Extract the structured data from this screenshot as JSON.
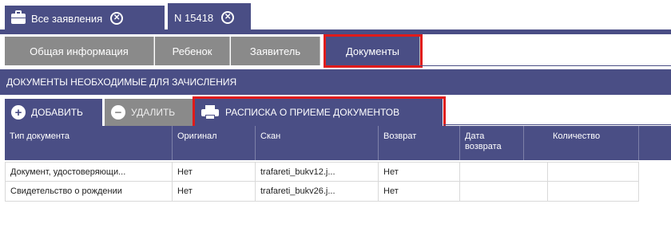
{
  "doc_tabs": [
    {
      "label": "Все заявления",
      "icon": "briefcase-icon",
      "close": "close-icon"
    },
    {
      "label": "N 15418",
      "close": "close-icon"
    }
  ],
  "section_tabs": [
    "Общая информация",
    "Ребенок",
    "Заявитель",
    "Документы"
  ],
  "active_section": "Документы",
  "section_title": "ДОКУМЕНТЫ НЕОБХОДИМЫЕ ДЛЯ ЗАЧИСЛЕНИЯ",
  "toolbar": {
    "add_label": "ДОБАВИТЬ",
    "delete_label": "УДАЛИТЬ",
    "receipt_label": "РАСПИСКА О ПРИЕМЕ ДОКУМЕНТОВ"
  },
  "table": {
    "columns": [
      "Тип документа",
      "Оригинал",
      "Скан",
      "Возврат",
      "Дата возврата",
      "Количество"
    ],
    "rows": [
      [
        "Документ, удостоверяющи...",
        "Нет",
        "trafareti_bukv12.j...",
        "Нет",
        "",
        ""
      ],
      [
        "Свидетельство о рождении",
        "Нет",
        "trafareti_bukv26.j...",
        "Нет",
        "",
        ""
      ]
    ]
  },
  "colors": {
    "primary": "#4a4e85",
    "inactive": "#8a8a8a",
    "highlight": "#e01b1b"
  }
}
